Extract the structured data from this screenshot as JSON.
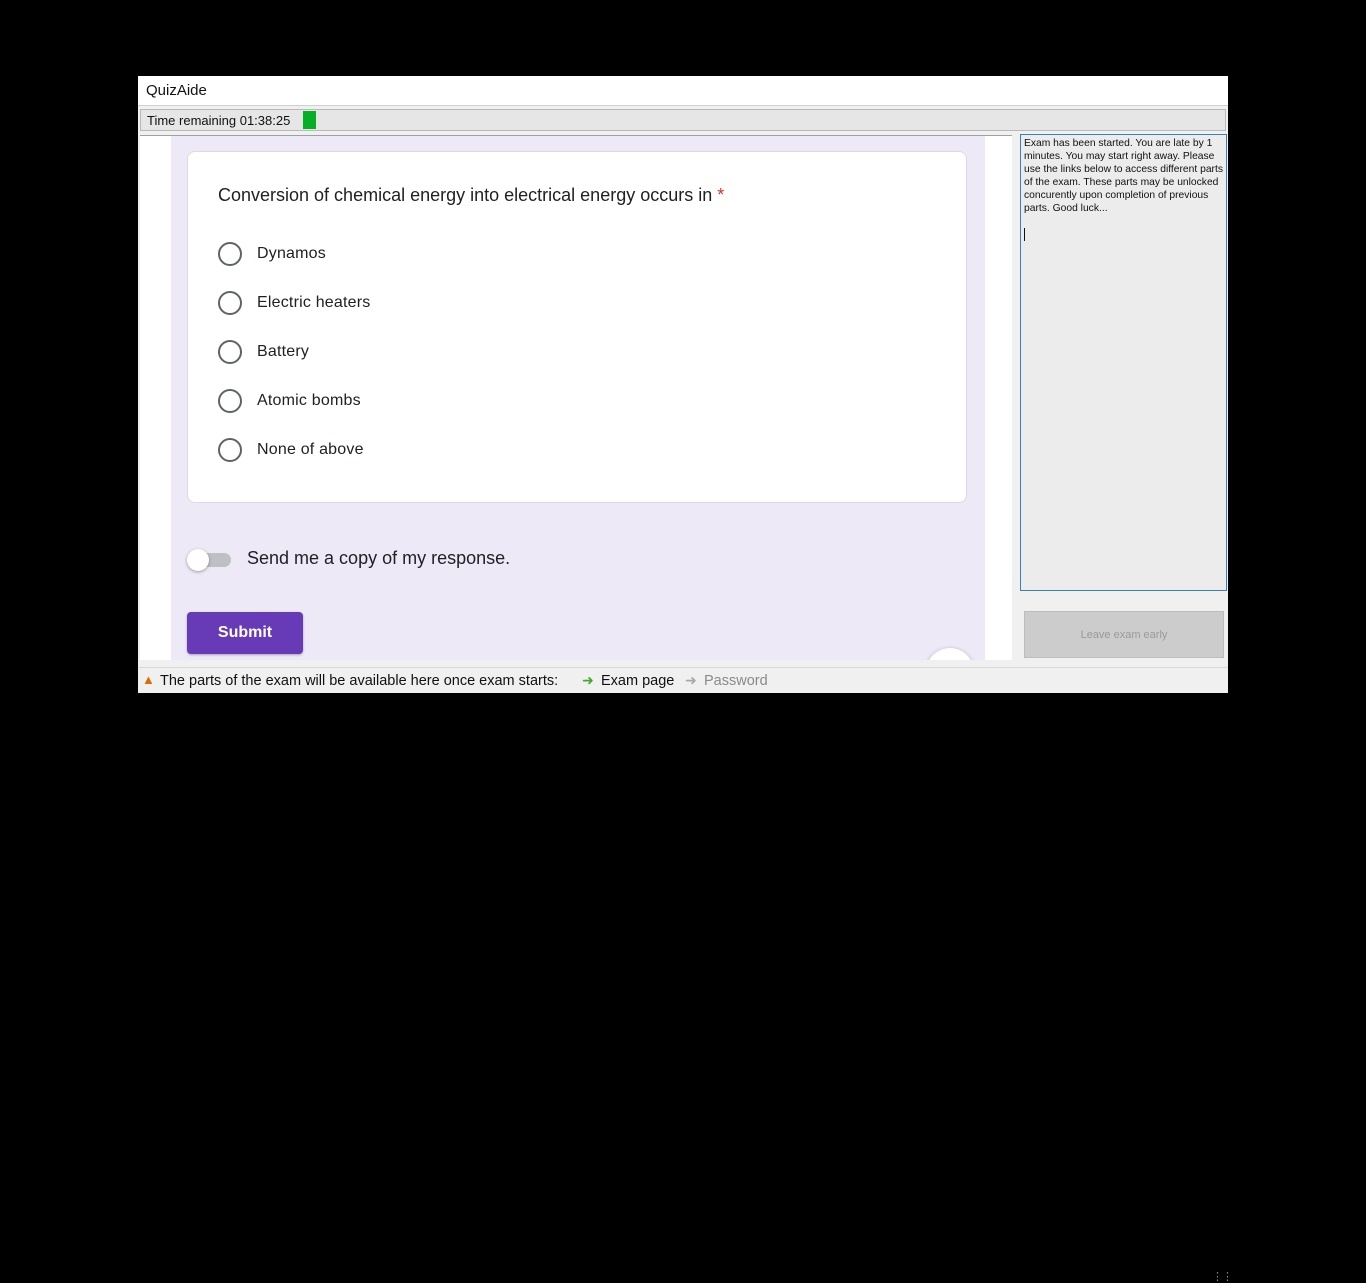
{
  "app": {
    "title": "QuizAide"
  },
  "timer": {
    "label": "Time remaining 01:38:25",
    "progress_fraction": 0.015,
    "progress_color": "#06b025"
  },
  "question": {
    "text": "Conversion of chemical energy into electrical energy occurs in",
    "required_mark": "*",
    "options": [
      "Dynamos",
      "Electric heaters",
      "Battery",
      "Atomic bombs",
      "None of above"
    ]
  },
  "copy_toggle": {
    "label": "Send me a copy of my response.",
    "state": "off"
  },
  "submit": {
    "label": "Submit",
    "color": "#673ab7"
  },
  "info": {
    "message": "Exam has been started. You are late by 1 minutes. You may start right away. Please use the links below to access different parts of the exam. These parts may be unlocked concurently upon completion of previous parts. Good luck..."
  },
  "leave_button": {
    "label": "Leave exam early"
  },
  "status": {
    "message": "The parts of the exam will be available here once exam starts:",
    "links": [
      {
        "label": "Exam page",
        "enabled": true,
        "icon": "arrow-right-icon"
      },
      {
        "label": "Password",
        "enabled": false,
        "icon": "arrow-right-icon"
      }
    ]
  },
  "icons": {
    "warning": "warning-icon"
  }
}
